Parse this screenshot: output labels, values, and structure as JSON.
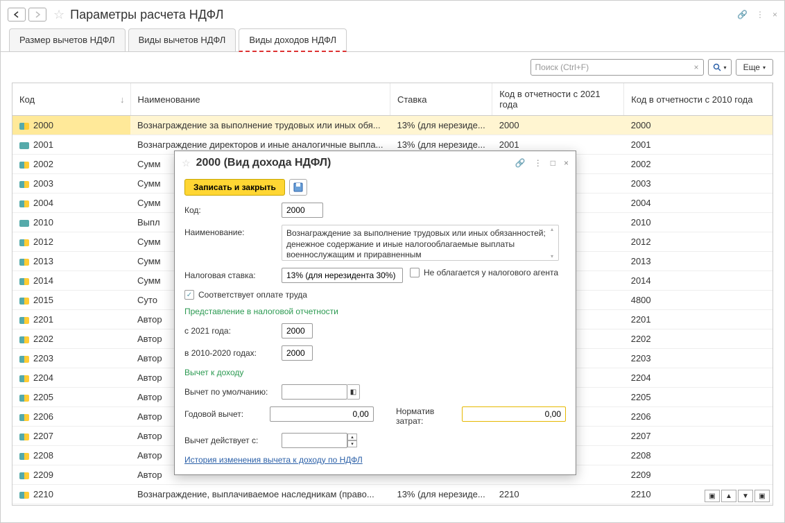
{
  "header": {
    "title": "Параметры расчета НДФЛ"
  },
  "tabs": [
    {
      "label": "Размер вычетов НДФЛ",
      "active": false
    },
    {
      "label": "Виды вычетов НДФЛ",
      "active": false
    },
    {
      "label": "Виды доходов НДФЛ",
      "active": true
    }
  ],
  "toolbar": {
    "search_placeholder": "Поиск (Ctrl+F)",
    "more_label": "Еще"
  },
  "table": {
    "columns": {
      "code": "Код",
      "name": "Наименование",
      "rate": "Ставка",
      "report2021": "Код в отчетности с 2021 года",
      "report2010": "Код в отчетности  с 2010 года"
    },
    "rows": [
      {
        "code": "2000",
        "name": "Вознаграждение за выполнение трудовых или иных обя...",
        "rate": "13% (для нерезиде...",
        "r21": "2000",
        "r10": "2000",
        "selected": true,
        "plain": false
      },
      {
        "code": "2001",
        "name": "Вознаграждение директоров и иные аналогичные выпла...",
        "rate": "13% (для нерезиде...",
        "r21": "2001",
        "r10": "2001",
        "plain": true
      },
      {
        "code": "2002",
        "name": "Сумм",
        "rate": "",
        "r21": "",
        "r10": "2002",
        "plain": false
      },
      {
        "code": "2003",
        "name": "Сумм",
        "rate": "",
        "r21": "",
        "r10": "2003",
        "plain": false
      },
      {
        "code": "2004",
        "name": "Сумм",
        "rate": "",
        "r21": "",
        "r10": "2004",
        "plain": false
      },
      {
        "code": "2010",
        "name": "Выпл",
        "rate": "",
        "r21": "",
        "r10": "2010",
        "plain": true
      },
      {
        "code": "2012",
        "name": "Сумм",
        "rate": "",
        "r21": "",
        "r10": "2012",
        "plain": false
      },
      {
        "code": "2013",
        "name": "Сумм",
        "rate": "",
        "r21": "",
        "r10": "2013",
        "plain": false
      },
      {
        "code": "2014",
        "name": "Сумм",
        "rate": "",
        "r21": "",
        "r10": "2014",
        "plain": false
      },
      {
        "code": "2015",
        "name": "Суто",
        "rate": "",
        "r21": "",
        "r10": "4800",
        "plain": false
      },
      {
        "code": "2201",
        "name": "Автор",
        "rate": "",
        "r21": "",
        "r10": "2201",
        "plain": false
      },
      {
        "code": "2202",
        "name": "Автор",
        "rate": "",
        "r21": "",
        "r10": "2202",
        "plain": false
      },
      {
        "code": "2203",
        "name": "Автор",
        "rate": "",
        "r21": "",
        "r10": "2203",
        "plain": false
      },
      {
        "code": "2204",
        "name": "Автор",
        "rate": "",
        "r21": "",
        "r10": "2204",
        "plain": false
      },
      {
        "code": "2205",
        "name": "Автор",
        "rate": "",
        "r21": "",
        "r10": "2205",
        "plain": false
      },
      {
        "code": "2206",
        "name": "Автор",
        "rate": "",
        "r21": "",
        "r10": "2206",
        "plain": false
      },
      {
        "code": "2207",
        "name": "Автор",
        "rate": "",
        "r21": "",
        "r10": "2207",
        "plain": false
      },
      {
        "code": "2208",
        "name": "Автор",
        "rate": "",
        "r21": "",
        "r10": "2208",
        "plain": false
      },
      {
        "code": "2209",
        "name": "Автор",
        "rate": "",
        "r21": "",
        "r10": "2209",
        "plain": false
      },
      {
        "code": "2210",
        "name": "Вознаграждение, выплачиваемое наследникам (право...",
        "rate": "13% (для нерезиде...",
        "r21": "2210",
        "r10": "2210",
        "plain": false
      }
    ]
  },
  "dialog": {
    "title": "2000 (Вид дохода НДФЛ)",
    "save_close": "Записать и закрыть",
    "labels": {
      "code": "Код:",
      "name": "Наименование:",
      "rate": "Налоговая ставка:",
      "not_taxed": "Не облагается у налогового агента",
      "is_salary": "Соответствует оплате труда",
      "section_report": "Представление в налоговой отчетности",
      "from2021": "с 2021 года:",
      "in2010_2020": "в 2010-2020 годах:",
      "section_deduction": "Вычет к доходу",
      "default_deduction": "Вычет по умолчанию:",
      "annual_deduction": "Годовой вычет:",
      "cost_norm": "Норматив затрат:",
      "deduction_from": "Вычет действует с:",
      "history_link": "История изменения вычета к доходу по НДФЛ"
    },
    "values": {
      "code": "2000",
      "name": "Вознаграждение за выполнение трудовых или иных обязанностей; денежное содержание и иные налогооблагаемые выплаты военнослужащим и приравненным",
      "rate": "13% (для нерезидента 30%)",
      "not_taxed_checked": false,
      "is_salary_checked": true,
      "from2021": "2000",
      "in2010_2020": "2000",
      "default_deduction": "",
      "annual_deduction": "0,00",
      "cost_norm": "0,00",
      "deduction_from": ""
    }
  }
}
